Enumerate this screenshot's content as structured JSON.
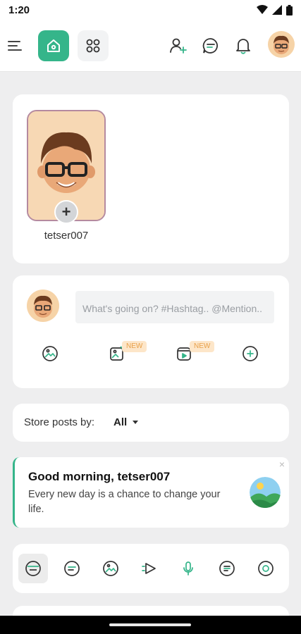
{
  "status": {
    "time": "1:20"
  },
  "header": {
    "menu_icon": "menu-icon",
    "home_icon": "home-icon",
    "apps_icon": "apps-grid-icon",
    "add_friend_icon": "add-user-icon",
    "messages_icon": "chat-icon",
    "notifications_icon": "bell-icon",
    "accent_color": "#35b58a"
  },
  "story": {
    "username": "tetser007"
  },
  "composer": {
    "placeholder": "What's going on? #Hashtag.. @Mention.. Link..",
    "actions": [
      {
        "icon": "image-icon"
      },
      {
        "icon": "image-edit-icon",
        "badge": "NEW"
      },
      {
        "icon": "reel-icon",
        "badge": "NEW"
      },
      {
        "icon": "plus-circle-icon"
      }
    ]
  },
  "filter": {
    "label": "Store posts by:",
    "value": "All"
  },
  "greeting": {
    "title": "Good morning, tetser007",
    "body": "Every new day is a chance to change your life.",
    "close": "×"
  },
  "post_types": [
    {
      "icon": "all-posts-icon",
      "active": true
    },
    {
      "icon": "text-post-icon"
    },
    {
      "icon": "photo-post-icon"
    },
    {
      "icon": "video-post-icon"
    },
    {
      "icon": "audio-post-icon"
    },
    {
      "icon": "document-post-icon"
    },
    {
      "icon": "link-post-icon"
    }
  ]
}
